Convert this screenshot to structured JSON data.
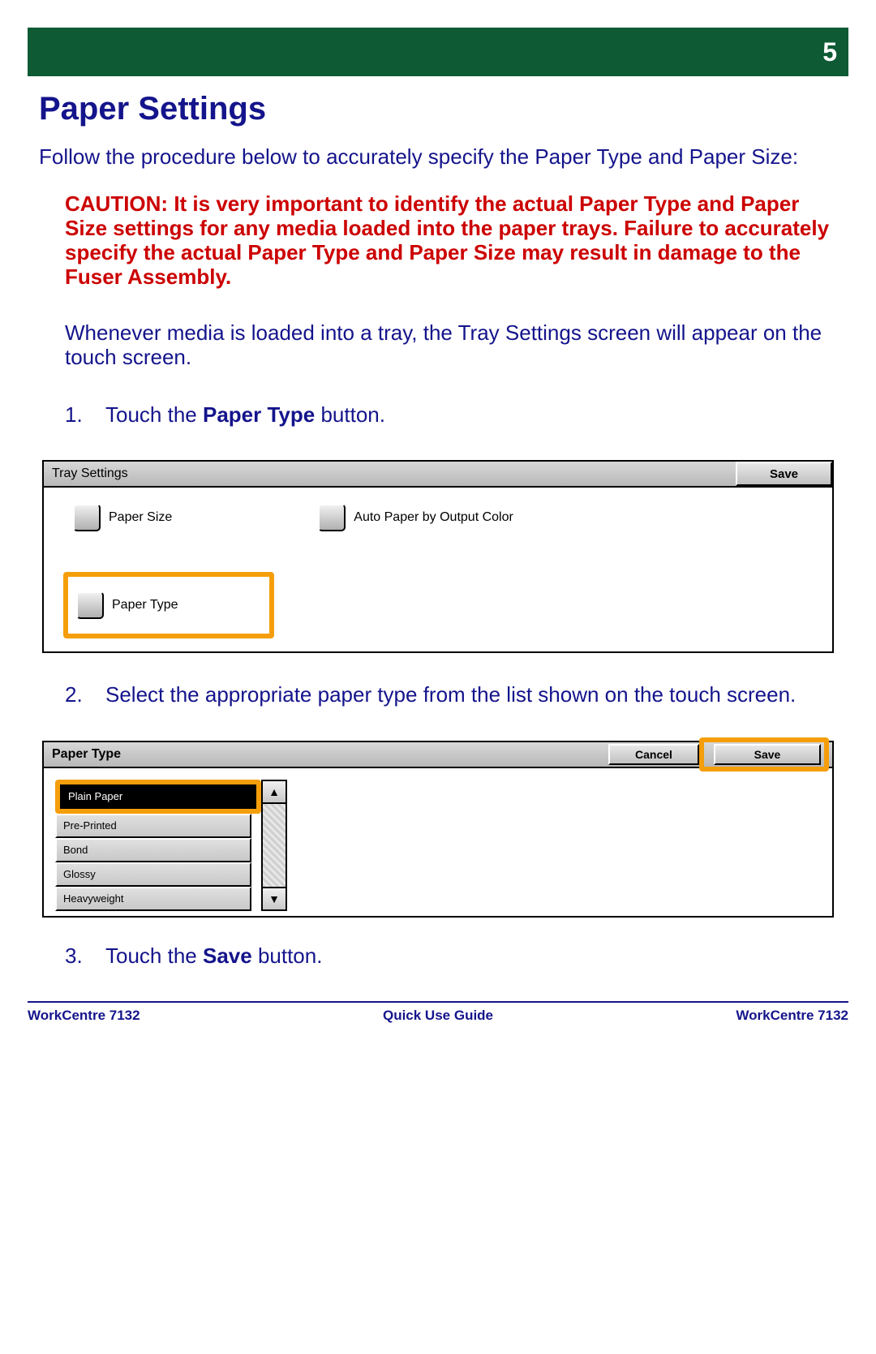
{
  "chapter_number": "5",
  "title": "Paper Settings",
  "intro": "Follow the procedure below to accurately specify the Paper Type and Paper Size:",
  "caution": "CAUTION:  It is very important to identify the actual Paper Type and Paper Size settings for any media loaded into the paper trays. Failure to accurately specify the actual Paper Type and Paper Size may result in damage to the Fuser Assembly.",
  "explain": "Whenever media is loaded into a tray, the Tray Settings screen will appear on the touch screen.",
  "steps": {
    "s1_pre": "Touch the ",
    "s1_bold": "Paper Type",
    "s1_post": " button.",
    "s2": "Select the appropriate paper type from the list shown on the touch screen.",
    "s3_pre": "Touch the ",
    "s3_bold": "Save",
    "s3_post": " button."
  },
  "panel1": {
    "title": "Tray Settings",
    "save": "Save",
    "paper_size": "Paper Size",
    "auto_color": "Auto Paper by Output Color",
    "paper_type": "Paper Type"
  },
  "panel2": {
    "title": "Paper Type",
    "cancel": "Cancel",
    "save": "Save",
    "items": [
      "Plain Paper",
      "Pre-Printed",
      "Bond",
      "Glossy",
      "Heavyweight"
    ]
  },
  "footer": {
    "left": "WorkCentre 7132",
    "center": "Quick Use Guide",
    "right": "WorkCentre 7132"
  }
}
